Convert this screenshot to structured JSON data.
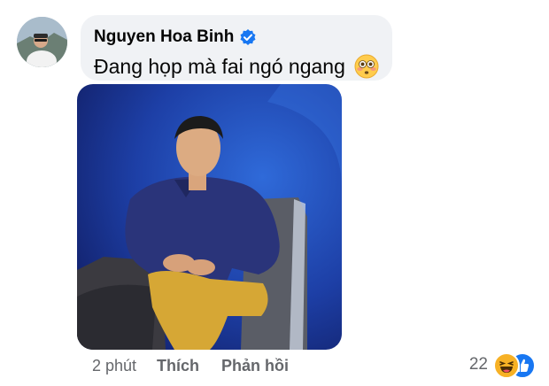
{
  "comment": {
    "author": "Nguyen Hoa Binh",
    "verified": true,
    "text": "Đang họp mà fai ngó ngang",
    "emoji": "flushed-face-icon"
  },
  "actions": {
    "time": "2 phút",
    "like_label": "Thích",
    "reply_label": "Phản hồi"
  },
  "reactions": {
    "count": "22",
    "types": [
      "haha-reaction-icon",
      "like-reaction-icon"
    ]
  },
  "colors": {
    "bubble": "#f0f2f5",
    "verified_blue": "#1877f2",
    "meta_gray": "#65676b",
    "photo_background": "#1d3fa6"
  }
}
